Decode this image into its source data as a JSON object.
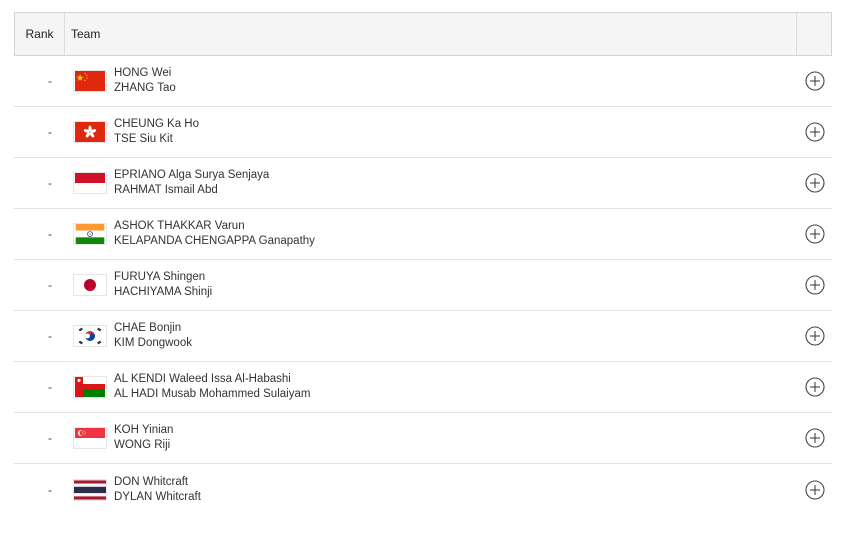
{
  "table": {
    "headers": {
      "rank": "Rank",
      "team": "Team"
    },
    "rows": [
      {
        "rank": "-",
        "flag": "china-flag-icon",
        "player1": "HONG Wei",
        "player2": "ZHANG Tao"
      },
      {
        "rank": "-",
        "flag": "hong-kong-flag-icon",
        "player1": "CHEUNG Ka Ho",
        "player2": "TSE Siu Kit"
      },
      {
        "rank": "-",
        "flag": "indonesia-flag-icon",
        "player1": "EPRIANO Alga Surya Senjaya",
        "player2": "RAHMAT Ismail Abd"
      },
      {
        "rank": "-",
        "flag": "india-flag-icon",
        "player1": "ASHOK THAKKAR Varun",
        "player2": "KELAPANDA CHENGAPPA Ganapathy"
      },
      {
        "rank": "-",
        "flag": "japan-flag-icon",
        "player1": "FURUYA Shingen",
        "player2": "HACHIYAMA Shinji"
      },
      {
        "rank": "-",
        "flag": "south-korea-flag-icon",
        "player1": "CHAE Bonjin",
        "player2": "KIM Dongwook"
      },
      {
        "rank": "-",
        "flag": "oman-flag-icon",
        "player1": "AL KENDI Waleed Issa Al-Habashi",
        "player2": "AL HADI Musab Mohammed Sulaiyam"
      },
      {
        "rank": "-",
        "flag": "singapore-flag-icon",
        "player1": "KOH Yinian",
        "player2": "WONG Riji"
      },
      {
        "rank": "-",
        "flag": "thailand-flag-icon",
        "player1": "DON Whitcraft",
        "player2": "DYLAN Whitcraft"
      }
    ]
  },
  "colors": {
    "header_bg": "#f5f5f5",
    "border": "#d4d4d4",
    "row_divider": "#e2e2e2",
    "icon": "#444444"
  }
}
